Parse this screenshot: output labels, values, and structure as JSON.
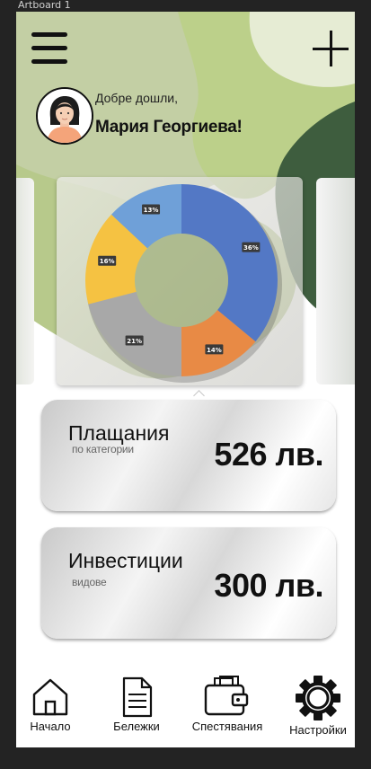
{
  "artboard": {
    "label": "Artboard 1"
  },
  "header": {
    "menu_icon": "hamburger-menu-icon",
    "add_icon": "plus-icon",
    "greeting": "Добре дошли,",
    "user_name": "Мария Георгиева!"
  },
  "colors": {
    "pie_blue": "#5378c5",
    "pie_orange": "#e88a45",
    "pie_gray": "#a8a8a8",
    "pie_yellow": "#f5c242",
    "pie_lightblue": "#6fa0d8",
    "bg_green_light": "#b9cc8d",
    "bg_green_dark": "#2f4a30"
  },
  "chart_data": {
    "type": "pie",
    "variant": "donut",
    "title": "",
    "categories": [
      "",
      "",
      "",
      "",
      ""
    ],
    "values": [
      36,
      14,
      21,
      16,
      13
    ],
    "labels": [
      "36%",
      "14%",
      "21%",
      "16%",
      "13%"
    ],
    "colors": [
      "#5378c5",
      "#e88a45",
      "#a8a8a8",
      "#f5c242",
      "#6fa0d8"
    ],
    "legend": "none"
  },
  "cards": [
    {
      "title": "Плащания",
      "subtitle": "по категории",
      "amount": "526 лв."
    },
    {
      "title": "Инвестиции",
      "subtitle": "видове",
      "amount": "300 лв."
    }
  ],
  "nav": {
    "home": {
      "label": "Начало",
      "icon": "home-icon"
    },
    "notes": {
      "label": "Бележки",
      "icon": "document-icon"
    },
    "savings": {
      "label": "Спестявания",
      "icon": "wallet-icon"
    },
    "settings": {
      "label": "Настройки",
      "icon": "gear-icon"
    }
  }
}
